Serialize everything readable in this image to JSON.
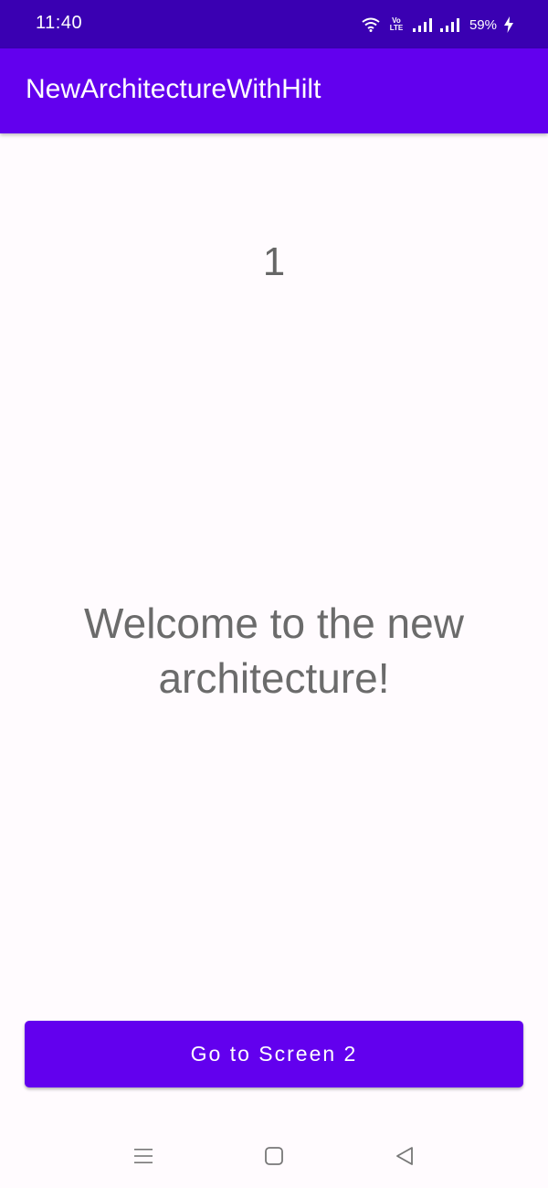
{
  "status_bar": {
    "time": "11:40",
    "volte_top": "Vo",
    "volte_bottom": "LTE",
    "battery": "59%"
  },
  "app_bar": {
    "title": "NewArchitectureWithHilt"
  },
  "main": {
    "counter": "1",
    "welcome": "Welcome to the new architecture!",
    "button_label": "Go to Screen 2"
  },
  "colors": {
    "status_bar": "#3a00b2",
    "primary": "#6200ee",
    "background": "#fffbfe",
    "text_secondary": "#666666"
  },
  "nav_bar": {
    "icons": [
      "menu-icon",
      "home-icon",
      "back-icon"
    ]
  }
}
